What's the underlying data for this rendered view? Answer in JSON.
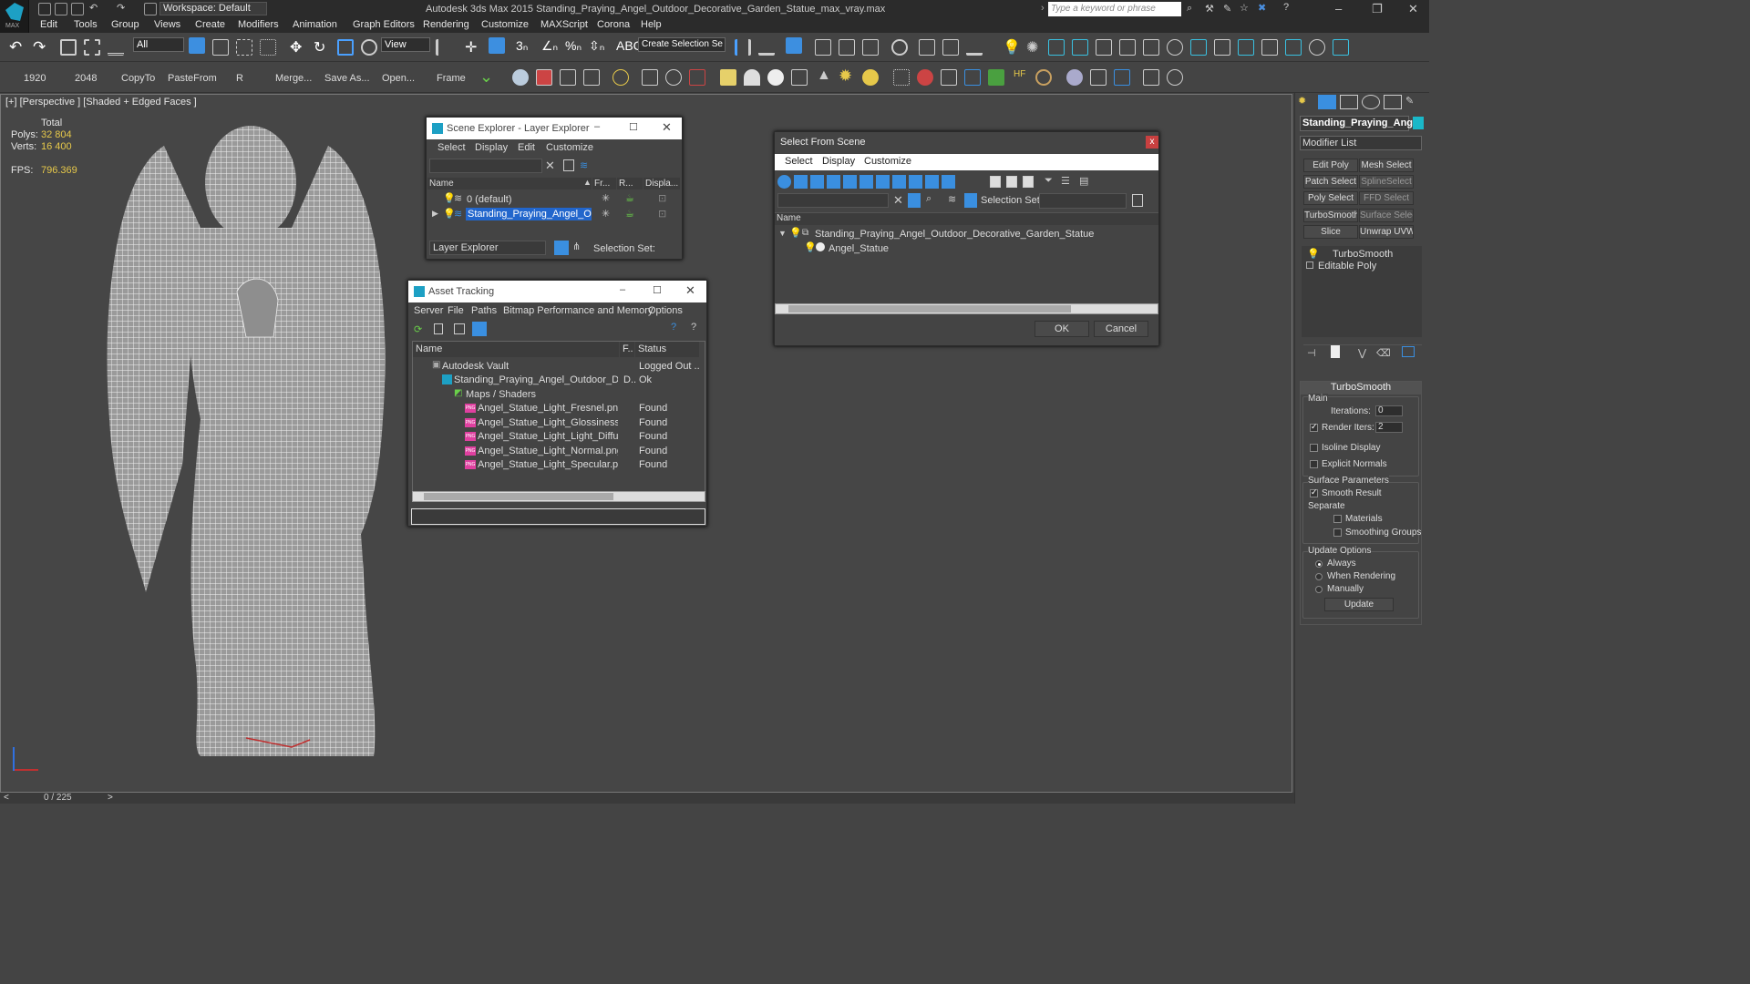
{
  "app": {
    "logo_text": "MAX",
    "workspace": "Workspace: Default",
    "title": "Autodesk 3ds Max  2015     Standing_Praying_Angel_Outdoor_Decorative_Garden_Statue_max_vray.max",
    "search_placeholder": "Type a keyword or phrase"
  },
  "menu": [
    "Edit",
    "Tools",
    "Group",
    "Views",
    "Create",
    "Modifiers",
    "Animation",
    "Graph Editors",
    "Rendering",
    "Customize",
    "MAXScript",
    "Corona",
    "Help"
  ],
  "toolbar": {
    "selection_filter": "All",
    "ref_coord": "View",
    "named_selection": "Create Selection Se"
  },
  "toolbar2": [
    "1920",
    "2048",
    "CopyTo",
    "PasteFrom",
    "R",
    "Merge...",
    "Save As...",
    "Open...",
    "Frame"
  ],
  "viewport": {
    "label": "[+] [Perspective ] [Shaded + Edged Faces ]",
    "stats": {
      "total_label": "Total",
      "polys_label": "Polys:",
      "polys": "32 804",
      "verts_label": "Verts:",
      "verts": "16 400",
      "fps_label": "FPS:",
      "fps": "796.369"
    }
  },
  "timeline": {
    "frame": "0 / 225",
    "left_arrow": "<",
    "right_arrow": ">"
  },
  "command_panel": {
    "object_name": "Standing_Praying_Angel",
    "object_color": "#1ab8c8",
    "modifier_list": "Modifier List",
    "mod_buttons": [
      "Edit Poly",
      "Mesh Select",
      "Patch Select",
      "SplineSelect",
      "Poly Select",
      "FFD Select",
      "TurboSmooth",
      "Surface Select",
      "Slice",
      "Unwrap UVW"
    ],
    "stack": [
      "TurboSmooth",
      "Editable Poly"
    ],
    "rollout": {
      "title": "TurboSmooth",
      "main": "Main",
      "iterations_label": "Iterations:",
      "iterations": "0",
      "render_iters_label": "Render Iters:",
      "render_iters": "2",
      "isoline": "Isoline Display",
      "explicit_normals": "Explicit Normals",
      "surface_params": "Surface Parameters",
      "smooth_result": "Smooth Result",
      "separate": "Separate",
      "materials": "Materials",
      "smoothing_groups": "Smoothing Groups",
      "update_options": "Update Options",
      "always": "Always",
      "when_rendering": "When Rendering",
      "manually": "Manually",
      "update_btn": "Update"
    }
  },
  "scene_explorer": {
    "title": "Scene Explorer - Layer Explorer",
    "menu": [
      "Select",
      "Display",
      "Edit",
      "Customize"
    ],
    "columns": [
      "Name",
      "Fr...",
      "R...",
      "Displa..."
    ],
    "rows": [
      "0 (default)",
      "Standing_Praying_Angel_Outdo..."
    ],
    "footer_combo": "Layer Explorer",
    "selection_set_label": "Selection Set:"
  },
  "asset_tracking": {
    "title": "Asset Tracking",
    "menu": [
      "Server",
      "File",
      "Paths",
      "Bitmap Performance and Memory",
      "Options"
    ],
    "columns": [
      "Name",
      "F..",
      "Status"
    ],
    "rows": [
      {
        "name": "Autodesk Vault",
        "f": "",
        "status": "Logged Out ..."
      },
      {
        "name": "Standing_Praying_Angel_Outdoor_Deco...",
        "f": "D..",
        "status": "Ok"
      },
      {
        "name": "Maps / Shaders",
        "f": "",
        "status": ""
      },
      {
        "name": "Angel_Statue_Light_Fresnel.png",
        "f": "",
        "status": "Found"
      },
      {
        "name": "Angel_Statue_Light_Glossiness.png",
        "f": "",
        "status": "Found"
      },
      {
        "name": "Angel_Statue_Light_Light_Diffuse....",
        "f": "",
        "status": "Found"
      },
      {
        "name": "Angel_Statue_Light_Normal.png",
        "f": "",
        "status": "Found"
      },
      {
        "name": "Angel_Statue_Light_Specular.png",
        "f": "",
        "status": "Found"
      }
    ]
  },
  "select_from_scene": {
    "title": "Select From Scene",
    "close": "x",
    "menu": [
      "Select",
      "Display",
      "Customize"
    ],
    "selection_set_label": "Selection Set:",
    "column": "Name",
    "rows": [
      "Standing_Praying_Angel_Outdoor_Decorative_Garden_Statue",
      "Angel_Statue"
    ],
    "ok": "OK",
    "cancel": "Cancel"
  }
}
